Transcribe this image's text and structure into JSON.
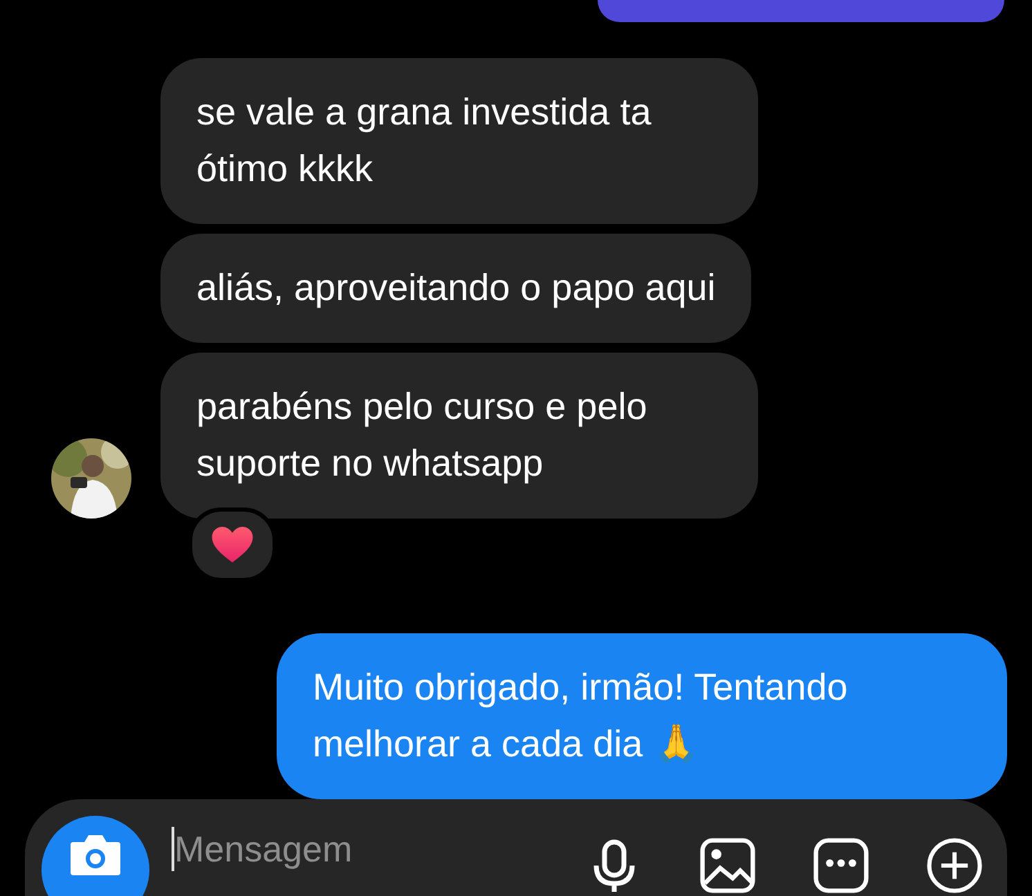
{
  "messages": [
    {
      "kind": "sent-edge"
    },
    {
      "kind": "received",
      "text": "se vale a grana investida ta ótimo kkkk",
      "avatar": false,
      "reaction": false
    },
    {
      "kind": "received",
      "text": "aliás, aproveitando o papo aqui",
      "avatar": false,
      "reaction": false
    },
    {
      "kind": "received",
      "text": "parabéns pelo curso e pelo suporte no whatsapp",
      "avatar": true,
      "reaction": true
    },
    {
      "kind": "sent",
      "text": "Muito obrigado, irmão! Tentando melhorar a cada dia 🙏"
    }
  ],
  "composer": {
    "placeholder": "Mensagem"
  }
}
